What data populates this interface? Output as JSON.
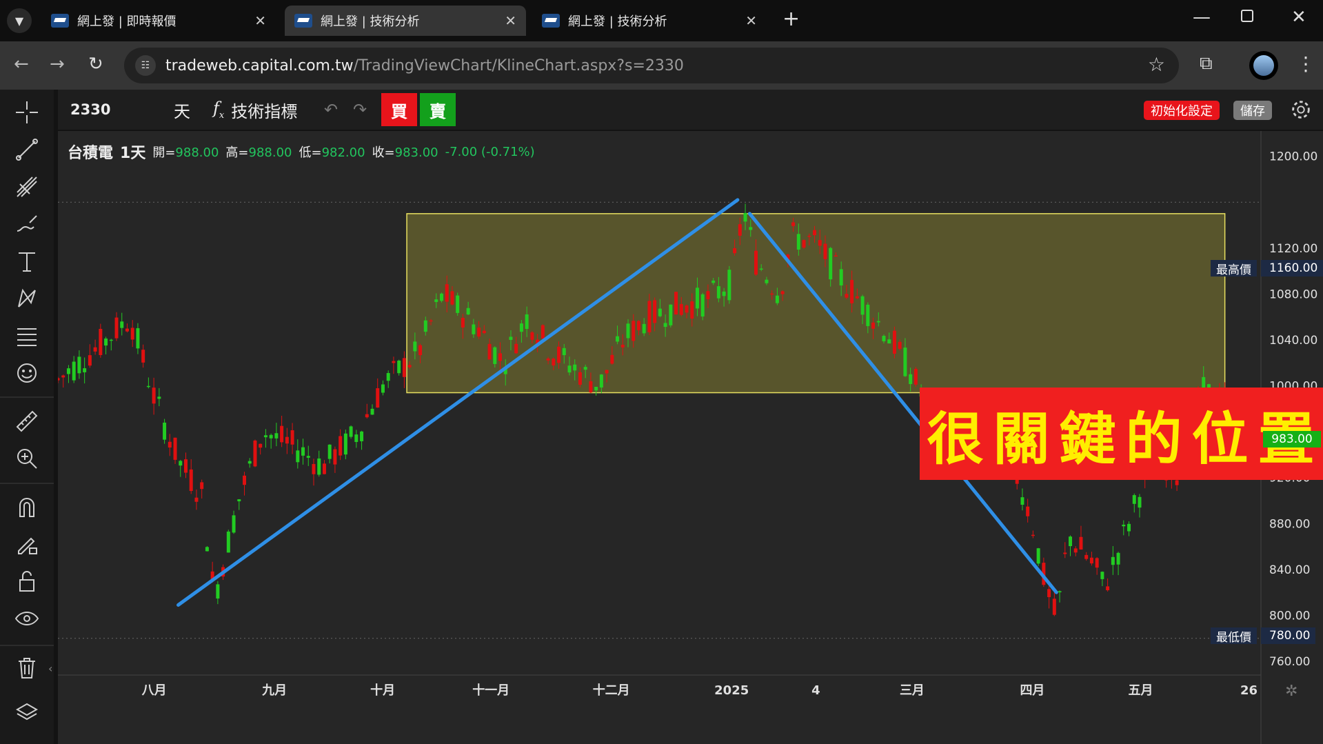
{
  "browser": {
    "tabs": [
      {
        "title": "網上發 | 即時報價",
        "active": false
      },
      {
        "title": "網上發 | 技術分析",
        "active": true
      },
      {
        "title": "網上發 | 技術分析",
        "active": false
      }
    ],
    "url_host": "tradeweb.capital.com.tw",
    "url_path": "/TradingViewChart/KlineChart.aspx?s=2330"
  },
  "toolbar": {
    "symbol": "2330",
    "interval": "天",
    "indicators_label": "技術指標",
    "buy_label": "買",
    "sell_label": "賣",
    "reset_label": "初始化設定",
    "save_label": "儲存"
  },
  "legend": {
    "name": "台積電",
    "interval": "1天",
    "open_label": "開=",
    "open": "988.00",
    "high_label": "高=",
    "high": "988.00",
    "low_label": "低=",
    "low": "982.00",
    "close_label": "收=",
    "close": "983.00",
    "change": "-7.00 (-0.71%)"
  },
  "annotation_text": "很關鍵的位置",
  "price_marks": {
    "high_label": "最高價",
    "high_value": "1160.00",
    "low_label": "最低價",
    "low_value": "780.00",
    "last_value": "983.00"
  },
  "chart_data": {
    "type": "candlestick",
    "symbol": "2330",
    "y_ticks": [
      1200,
      1160,
      1120,
      1080,
      1040,
      1000,
      960,
      920,
      880,
      840,
      800,
      780,
      760
    ],
    "ylim": [
      748,
      1222
    ],
    "x_ticks": [
      "八月",
      "九月",
      "十月",
      "十一月",
      "十二月",
      "2025",
      "4",
      "三月",
      "四月",
      "五月",
      "26"
    ],
    "x_tick_positions": [
      8,
      18,
      27,
      36,
      46,
      56,
      63,
      71,
      81,
      90,
      99
    ],
    "colors": {
      "up": "#e01010",
      "down": "#22cc22",
      "trendline": "#2f8fe6",
      "zone": "#e8e060"
    },
    "zone": {
      "x_start": 29,
      "x_end": 97,
      "y_low": 994,
      "y_high": 1150
    },
    "trendlines": [
      {
        "x0": 10,
        "y0": 809,
        "x1": 56.5,
        "y1": 1162
      },
      {
        "x0": 57.5,
        "y0": 1150,
        "x1": 83,
        "y1": 820
      }
    ],
    "ohlc": [
      [
        1005,
        1012,
        998,
        1002
      ],
      [
        1010,
        1020,
        1000,
        1015
      ],
      [
        1018,
        1035,
        1010,
        1030
      ],
      [
        1030,
        1065,
        1025,
        1060
      ],
      [
        1055,
        1075,
        1040,
        1045
      ],
      [
        1050,
        1060,
        1018,
        1025
      ],
      [
        1030,
        1050,
        1015,
        1042
      ],
      [
        1045,
        1085,
        1035,
        1078
      ],
      [
        1070,
        1078,
        1030,
        1035
      ],
      [
        1030,
        1060,
        1025,
        1055
      ],
      [
        1050,
        1060,
        1020,
        1030
      ],
      [
        1035,
        1045,
        1015,
        1025
      ],
      [
        1010,
        1018,
        980,
        986
      ],
      [
        985,
        1000,
        958,
        962
      ],
      [
        965,
        985,
        940,
        945
      ],
      [
        945,
        960,
        915,
        920
      ],
      [
        918,
        935,
        905,
        910
      ],
      [
        915,
        955,
        912,
        950
      ],
      [
        945,
        968,
        935,
        940
      ],
      [
        940,
        950,
        920,
        930
      ],
      [
        920,
        942,
        915,
        925
      ],
      [
        925,
        930,
        905,
        912
      ],
      [
        912,
        935,
        895,
        932
      ],
      [
        880,
        900,
        812,
        815
      ],
      [
        830,
        870,
        815,
        865
      ],
      [
        870,
        895,
        860,
        890
      ],
      [
        885,
        900,
        870,
        875
      ],
      [
        890,
        930,
        885,
        920
      ],
      [
        920,
        945,
        915,
        940
      ],
      [
        935,
        955,
        925,
        950
      ],
      [
        950,
        970,
        940,
        962
      ],
      [
        962,
        978,
        958,
        970
      ],
      [
        968,
        982,
        960,
        975
      ],
      [
        975,
        985,
        960,
        968
      ],
      [
        965,
        972,
        948,
        955
      ],
      [
        955,
        968,
        945,
        962
      ],
      [
        962,
        970,
        950,
        955
      ],
      [
        950,
        962,
        940,
        945
      ],
      [
        945,
        965,
        940,
        958
      ],
      [
        958,
        972,
        950,
        965
      ],
      [
        960,
        970,
        948,
        952
      ],
      [
        950,
        960,
        940,
        955
      ],
      [
        955,
        965,
        945,
        960
      ],
      [
        960,
        970,
        952,
        958
      ],
      [
        955,
        962,
        938,
        945
      ]
    ]
  }
}
